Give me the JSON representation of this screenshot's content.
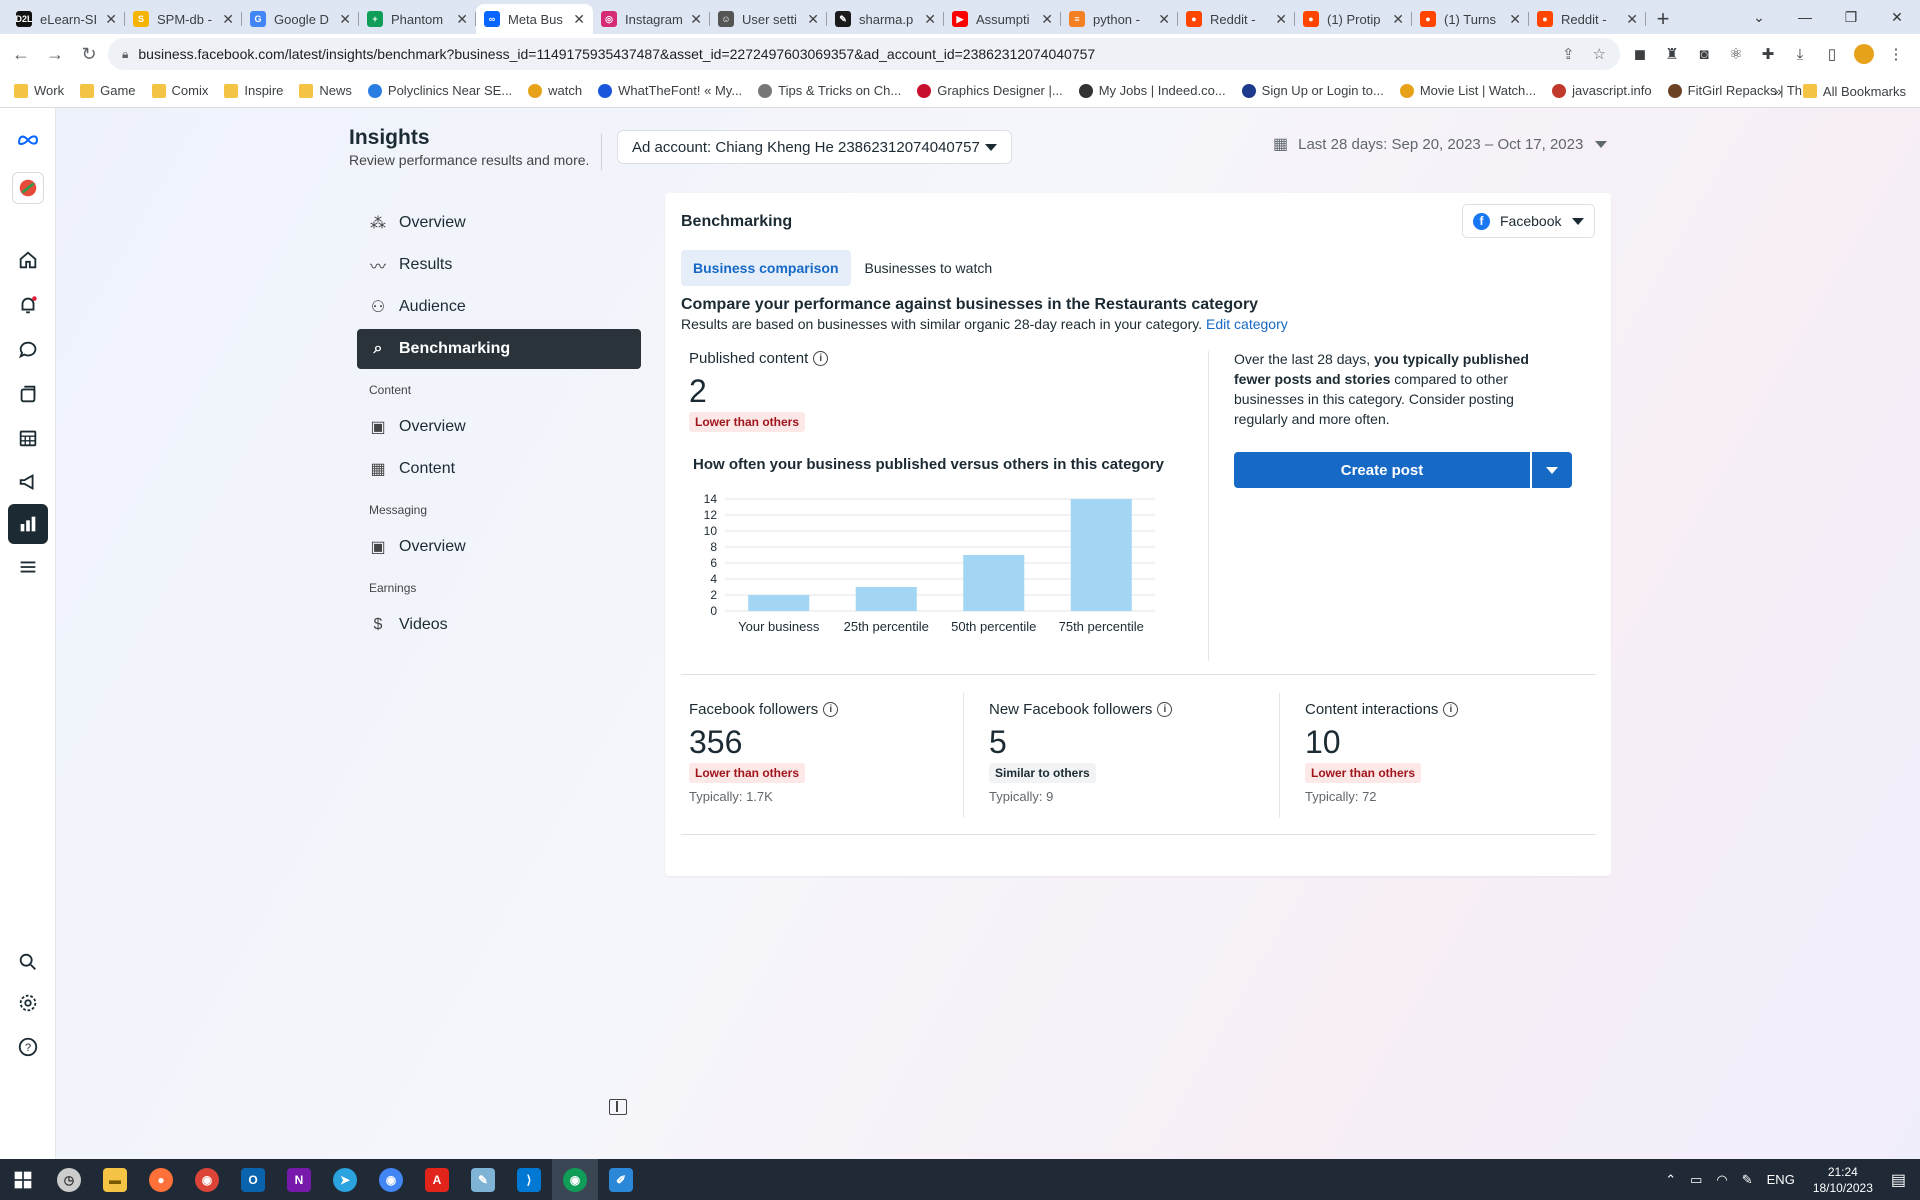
{
  "browser": {
    "tabs": [
      {
        "label": "eLearn-SI",
        "color": "#111111",
        "glyph": "D2L"
      },
      {
        "label": "SPM-db -",
        "color": "#f4b400",
        "glyph": "S"
      },
      {
        "label": "Google D",
        "color": "#4285f4",
        "glyph": "G"
      },
      {
        "label": "Phantom",
        "color": "#0f9d58",
        "glyph": "+"
      },
      {
        "label": "Meta Bus",
        "color": "#0866ff",
        "glyph": "∞",
        "active": true
      },
      {
        "label": "Instagram",
        "color": "#d62976",
        "glyph": "◎"
      },
      {
        "label": "User setti",
        "color": "#555555",
        "glyph": "☺"
      },
      {
        "label": "sharma.p",
        "color": "#1b1b1b",
        "glyph": "✎"
      },
      {
        "label": "Assumpti",
        "color": "#ff0000",
        "glyph": "▶"
      },
      {
        "label": "python -",
        "color": "#f48024",
        "glyph": "≡"
      },
      {
        "label": "Reddit -",
        "color": "#ff4500",
        "glyph": "●"
      },
      {
        "label": "(1) Protip",
        "color": "#ff4500",
        "glyph": "●"
      },
      {
        "label": "(1) Turns",
        "color": "#ff4500",
        "glyph": "●"
      },
      {
        "label": "Reddit -",
        "color": "#ff4500",
        "glyph": "●"
      }
    ],
    "url": "business.facebook.com/latest/insights/benchmark?business_id=1149175935437487&asset_id=2272497603069357&ad_account_id=23862312074040757",
    "bookmarks": [
      {
        "label": "Work",
        "type": "folder"
      },
      {
        "label": "Game",
        "type": "folder"
      },
      {
        "label": "Comix",
        "type": "folder"
      },
      {
        "label": "Inspire",
        "type": "folder"
      },
      {
        "label": "News",
        "type": "folder"
      },
      {
        "label": "Polyclinics Near SE...",
        "type": "site",
        "color": "#2a7de1"
      },
      {
        "label": "watch",
        "type": "site",
        "color": "#e8a21a"
      },
      {
        "label": "WhatTheFont! « My...",
        "type": "site",
        "color": "#1a56db"
      },
      {
        "label": "Tips & Tricks on Ch...",
        "type": "site",
        "color": "#777777"
      },
      {
        "label": "Graphics Designer |...",
        "type": "site",
        "color": "#c8102e"
      },
      {
        "label": "My Jobs | Indeed.co...",
        "type": "site",
        "color": "#333333"
      },
      {
        "label": "Sign Up or Login to...",
        "type": "site",
        "color": "#1e3a8a"
      },
      {
        "label": "Movie List | Watch...",
        "type": "site",
        "color": "#e8a21a"
      },
      {
        "label": "javascript.info",
        "type": "site",
        "color": "#c0392b"
      },
      {
        "label": "FitGirl Repacks | Th...",
        "type": "site",
        "color": "#6b4226"
      }
    ],
    "all_bookmarks": "All Bookmarks"
  },
  "header": {
    "title": "Insights",
    "subtitle": "Review performance results and more.",
    "ad_account": "Ad account: Chiang Kheng He 23862312074040757",
    "date_range": "Last 28 days: Sep 20, 2023 – Oct 17, 2023"
  },
  "nav": {
    "items": [
      {
        "label": "Overview",
        "icon": "overview-icon"
      },
      {
        "label": "Results",
        "icon": "results-icon"
      },
      {
        "label": "Audience",
        "icon": "audience-icon"
      },
      {
        "label": "Benchmarking",
        "icon": "benchmarking-icon",
        "active": true
      }
    ],
    "content_section": "Content",
    "content_items": [
      {
        "label": "Overview",
        "icon": "content-overview-icon"
      },
      {
        "label": "Content",
        "icon": "table-icon"
      }
    ],
    "messaging_section": "Messaging",
    "messaging_items": [
      {
        "label": "Overview",
        "icon": "messaging-overview-icon"
      }
    ],
    "earnings_section": "Earnings",
    "earnings_items": [
      {
        "label": "Videos",
        "icon": "dollar-icon"
      }
    ]
  },
  "card": {
    "title": "Benchmarking",
    "platform": "Facebook",
    "tabs": [
      "Business comparison",
      "Businesses to watch"
    ],
    "compare_heading": "Compare your performance against businesses in the Restaurants category",
    "compare_sub": "Results are based on businesses with similar organic 28-day reach in your category.",
    "edit_category": "Edit category",
    "published": {
      "label": "Published content",
      "value": "2",
      "badge": "Lower than others"
    },
    "chart_title": "How often your business published versus others in this category",
    "tip_prefix": "Over the last 28 days, ",
    "tip_bold": "you typically published fewer posts and stories",
    "tip_suffix": " compared to other businesses in this category. Consider posting regularly and more often.",
    "create_post": "Create post",
    "metrics": [
      {
        "label": "Facebook followers",
        "value": "356",
        "badge": "Lower than others",
        "badge_type": "lower",
        "typical": "Typically: 1.7K"
      },
      {
        "label": "New Facebook followers",
        "value": "5",
        "badge": "Similar to others",
        "badge_type": "similar",
        "typical": "Typically: 9"
      },
      {
        "label": "Content interactions",
        "value": "10",
        "badge": "Lower than others",
        "badge_type": "lower",
        "typical": "Typically: 72"
      }
    ]
  },
  "chart_data": {
    "type": "bar",
    "title": "How often your business published versus others in this category",
    "categories": [
      "Your business",
      "25th percentile",
      "50th percentile",
      "75th percentile"
    ],
    "values": [
      2,
      3,
      7,
      14
    ],
    "ylim": [
      0,
      14
    ],
    "yticks": [
      0,
      2,
      4,
      6,
      8,
      10,
      12,
      14
    ],
    "grid": true,
    "bar_color": "#a3d6f5"
  },
  "taskbar": {
    "time": "21:24",
    "date": "18/10/2023",
    "lang": "ENG"
  },
  "colors": {
    "accent": "#1769c6",
    "nav_active": "#293339",
    "lower_badge": "#fde8e8"
  }
}
